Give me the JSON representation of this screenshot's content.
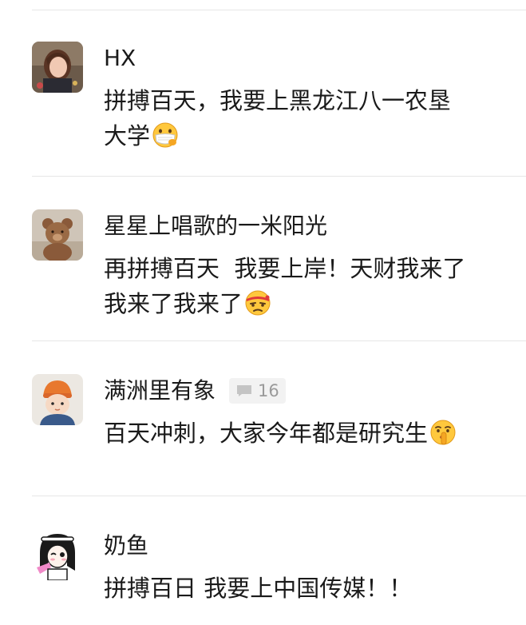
{
  "comments": [
    {
      "username": "HX",
      "text_line1": "拼搏百天，我要上黑龙江八一农垦",
      "text_line2": "大学",
      "emoji": "face-with-medical-mask",
      "avatar": "girl-photo-avatar"
    },
    {
      "username": "星星上唱歌的一米阳光",
      "text_line1": "再拼搏百天  我要上岸！天财我来了",
      "text_line2": "我来了我来了",
      "emoji": "face-with-headband-determined",
      "avatar": "teddy-bear-avatar"
    },
    {
      "username": "满洲里有象",
      "reply_count": "16",
      "text_line1": "百天冲刺，大家今年都是研究生",
      "emoji": "shushing-face",
      "avatar": "baby-orange-hat-avatar"
    },
    {
      "username": "奶鱼",
      "text_line1": "拼搏百日 我要上中国传媒！！",
      "avatar": "cartoon-girl-avatar"
    }
  ],
  "colors": {
    "divider": "#e6e6e6",
    "text": "#1a1a1a",
    "badge_bg": "#f2f2f2",
    "badge_text": "#9a9a9a"
  }
}
